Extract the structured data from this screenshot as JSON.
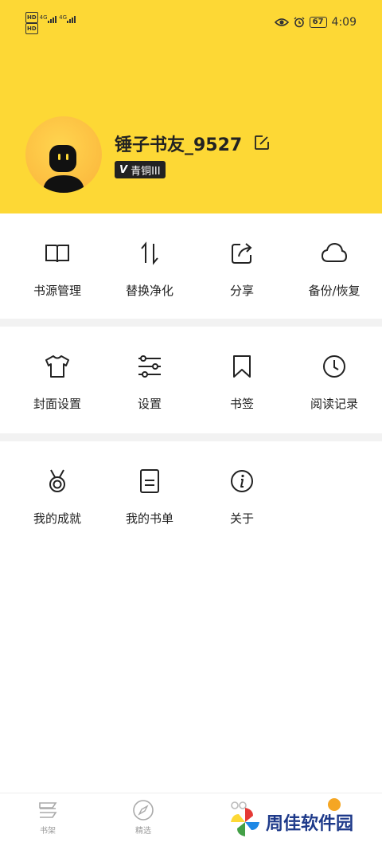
{
  "status_bar": {
    "hd1": "HD",
    "hd2": "HD",
    "net1": "4G",
    "net2": "4G",
    "battery": "67",
    "time": "4:09"
  },
  "profile": {
    "username": "锤子书友_9527",
    "badge_mark": "V",
    "badge_label": "青铜III"
  },
  "sections": [
    {
      "items": [
        {
          "label": "书源管理",
          "icon": "book-open-icon"
        },
        {
          "label": "替换净化",
          "icon": "swap-vertical-icon"
        },
        {
          "label": "分享",
          "icon": "share-icon"
        },
        {
          "label": "备份/恢复",
          "icon": "cloud-icon"
        }
      ]
    },
    {
      "items": [
        {
          "label": "封面设置",
          "icon": "shirt-icon"
        },
        {
          "label": "设置",
          "icon": "sliders-icon"
        },
        {
          "label": "书签",
          "icon": "bookmark-icon"
        },
        {
          "label": "阅读记录",
          "icon": "clock-icon"
        }
      ]
    },
    {
      "items": [
        {
          "label": "我的成就",
          "icon": "medal-icon"
        },
        {
          "label": "我的书单",
          "icon": "booklist-icon"
        },
        {
          "label": "关于",
          "icon": "info-icon"
        }
      ]
    }
  ],
  "tab_bar": {
    "tabs": [
      {
        "label": "书架",
        "icon": "bookshelf-icon"
      },
      {
        "label": "精选",
        "icon": "compass-icon"
      }
    ]
  },
  "watermark": {
    "text": "周佳软件园"
  },
  "colors": {
    "header_bg": "#fdd835",
    "accent_dot": "#f5a623"
  }
}
